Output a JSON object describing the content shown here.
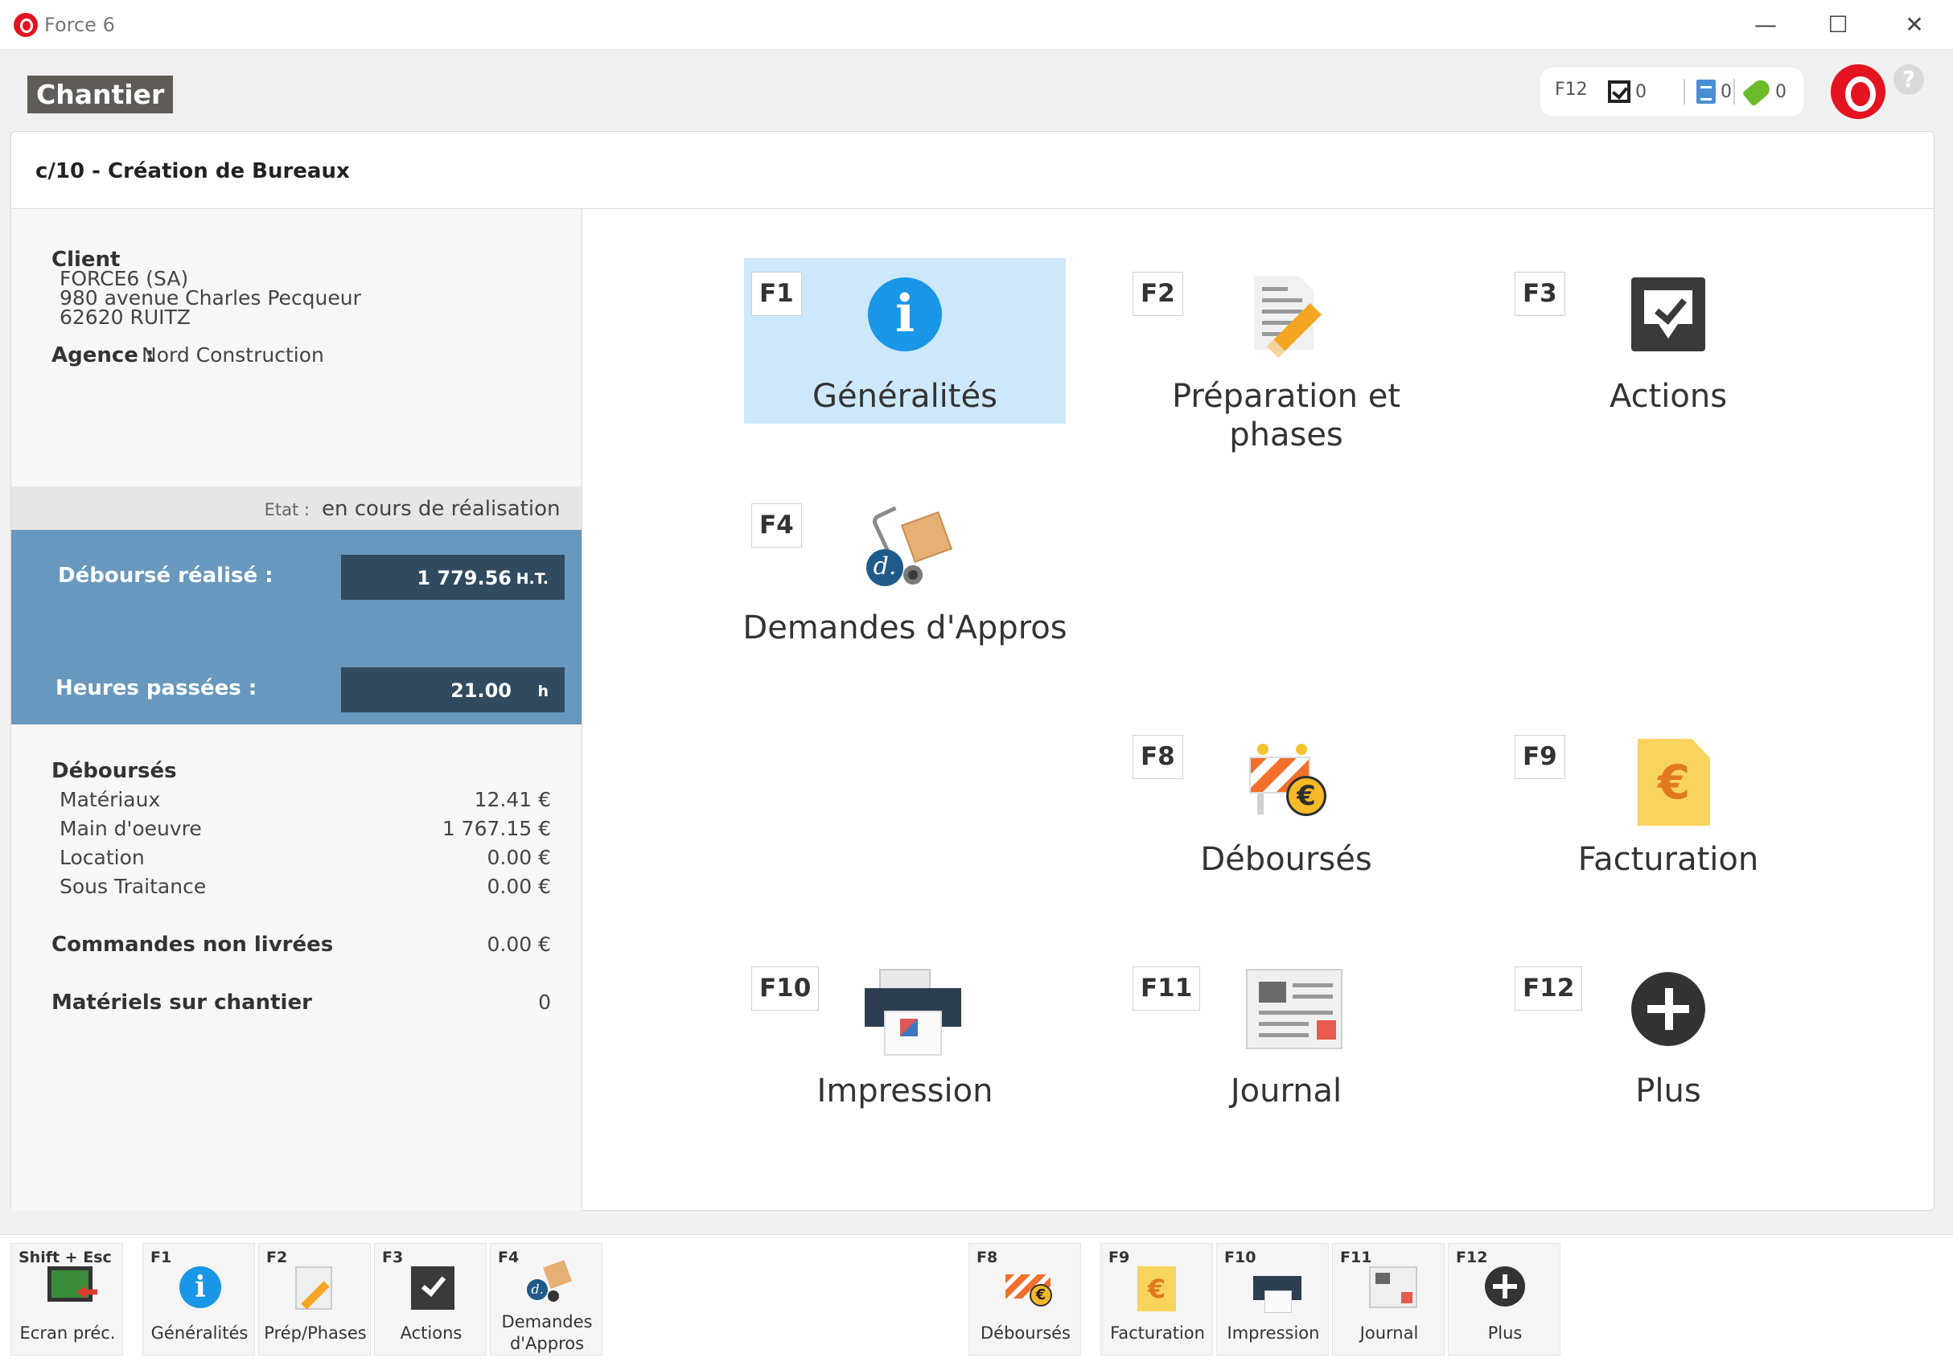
{
  "window": {
    "title": "Force 6",
    "controls": {
      "minimize": "—",
      "maximize": "☐",
      "close": "✕"
    }
  },
  "header": {
    "page_title": "Chantier",
    "status": {
      "key": "F12",
      "tasks_count": "0",
      "documents_count": "0",
      "tags_count": "0"
    },
    "help": "?"
  },
  "card": {
    "title": "c/10 - Création de Bureaux"
  },
  "left_panel": {
    "client_label": "Client",
    "client_name": "FORCE6 (SA)",
    "client_address1": "980 avenue Charles Pecqueur",
    "client_address2": "62620 RUITZ",
    "agence_label": "Agence :",
    "agence_value": "Nord Construction",
    "etat_label": "Etat :",
    "etat_value": "en cours de réalisation",
    "debourse_realise_label": "Déboursé réalisé :",
    "debourse_realise_value": "1 779.56",
    "debourse_realise_unit": "H.T.",
    "heures_label": "Heures passées :",
    "heures_value": "21.00",
    "heures_unit": "h",
    "debourses_title": "Déboursés",
    "rows": [
      {
        "label": "Matériaux",
        "value": "12.41 €"
      },
      {
        "label": "Main d'oeuvre",
        "value": "1 767.15 €"
      },
      {
        "label": "Location",
        "value": "0.00 €"
      },
      {
        "label": "Sous Traitance",
        "value": "0.00 €"
      }
    ],
    "commandes_label": "Commandes non livrées",
    "commandes_value": "0.00 €",
    "materiels_label": "Matériels sur chantier",
    "materiels_value": "0"
  },
  "tiles": {
    "generalites": {
      "key": "F1",
      "label": "Généralités",
      "icon": "info-icon"
    },
    "preparation": {
      "key": "F2",
      "label": "Préparation et phases",
      "icon": "document-pencil-icon"
    },
    "actions": {
      "key": "F3",
      "label": "Actions",
      "icon": "checkbox-icon"
    },
    "appros": {
      "key": "F4",
      "label": "Demandes d'Appros",
      "icon": "hand-truck-icon"
    },
    "debourses": {
      "key": "F8",
      "label": "Déboursés",
      "icon": "barrier-euro-icon"
    },
    "facturation": {
      "key": "F9",
      "label": "Facturation",
      "icon": "invoice-euro-icon"
    },
    "impression": {
      "key": "F10",
      "label": "Impression",
      "icon": "printer-icon"
    },
    "journal": {
      "key": "F11",
      "label": "Journal",
      "icon": "newspaper-icon"
    },
    "plus": {
      "key": "F12",
      "label": "Plus",
      "icon": "plus-icon"
    }
  },
  "toolbar": {
    "back": {
      "key": "Shift + Esc",
      "label": "Ecran préc."
    },
    "generalites": {
      "key": "F1",
      "label": "Généralités"
    },
    "prep": {
      "key": "F2",
      "label": "Prép/Phases"
    },
    "actions": {
      "key": "F3",
      "label": "Actions"
    },
    "appros": {
      "key": "F4",
      "label": "Demandes d'Appros"
    },
    "debourses": {
      "key": "F8",
      "label": "Déboursés"
    },
    "facturation": {
      "key": "F9",
      "label": "Facturation"
    },
    "impression": {
      "key": "F10",
      "label": "Impression"
    },
    "journal": {
      "key": "F11",
      "label": "Journal"
    },
    "plus": {
      "key": "F12",
      "label": "Plus"
    }
  },
  "colors": {
    "active_tile": "#cde8fb",
    "summary_block": "#6898bd",
    "summary_value_box": "#304a60",
    "brand_red": "#e3141f",
    "info_blue": "#1996e6"
  }
}
